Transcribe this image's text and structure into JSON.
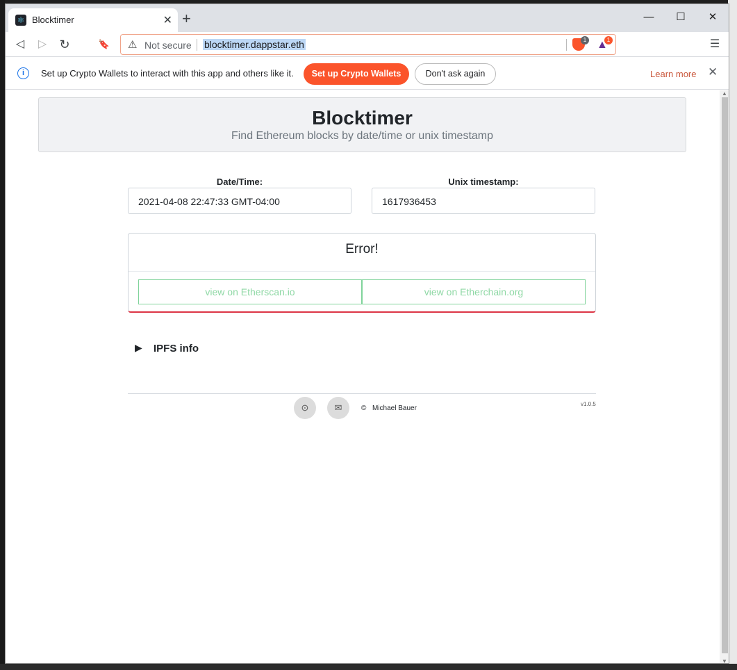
{
  "browser": {
    "tab": {
      "title": "Blocktimer",
      "close": "✕"
    },
    "new_tab": "+",
    "window_controls": {
      "minimize": "—",
      "maximize": "☐",
      "close": "✕"
    },
    "nav": {
      "back": "◁",
      "forward": "▷",
      "reload": "↻",
      "bookmark": "🔖",
      "menu": "☰"
    },
    "address": {
      "warning_icon": "⚠",
      "security_label": "Not secure",
      "url": "blocktimer.dappstar.eth",
      "brave_shield_count": "1",
      "rewards_count": "1"
    },
    "infobar": {
      "message": "Set up Crypto Wallets to interact with this app and others like it.",
      "primary_button": "Set up Crypto Wallets",
      "secondary_button": "Don't ask again",
      "learn_more": "Learn more",
      "close": "✕"
    }
  },
  "page": {
    "title": "Blocktimer",
    "subtitle": "Find Ethereum blocks by date/time or unix timestamp",
    "datetime": {
      "label": "Date/Time:",
      "value": "2021-04-08 22:47:33 GMT-04:00"
    },
    "unix": {
      "label": "Unix timestamp:",
      "value": "1617936453"
    },
    "result": {
      "heading": "Error!",
      "etherscan_link": "view on Etherscan.io",
      "etherchain_link": "view on Etherchain.org"
    },
    "ipfs": {
      "caret": "▶",
      "label": "IPFS info"
    },
    "footer": {
      "github_icon": "⊙",
      "mail_icon": "✉",
      "copyright_icon": "©",
      "author": "Michael Bauer",
      "version": "v1.0.5"
    }
  },
  "colors": {
    "accent": "#fb542b",
    "error": "#dc3545",
    "link_green": "#8fd8a5",
    "info_blue": "#1a73e8"
  }
}
